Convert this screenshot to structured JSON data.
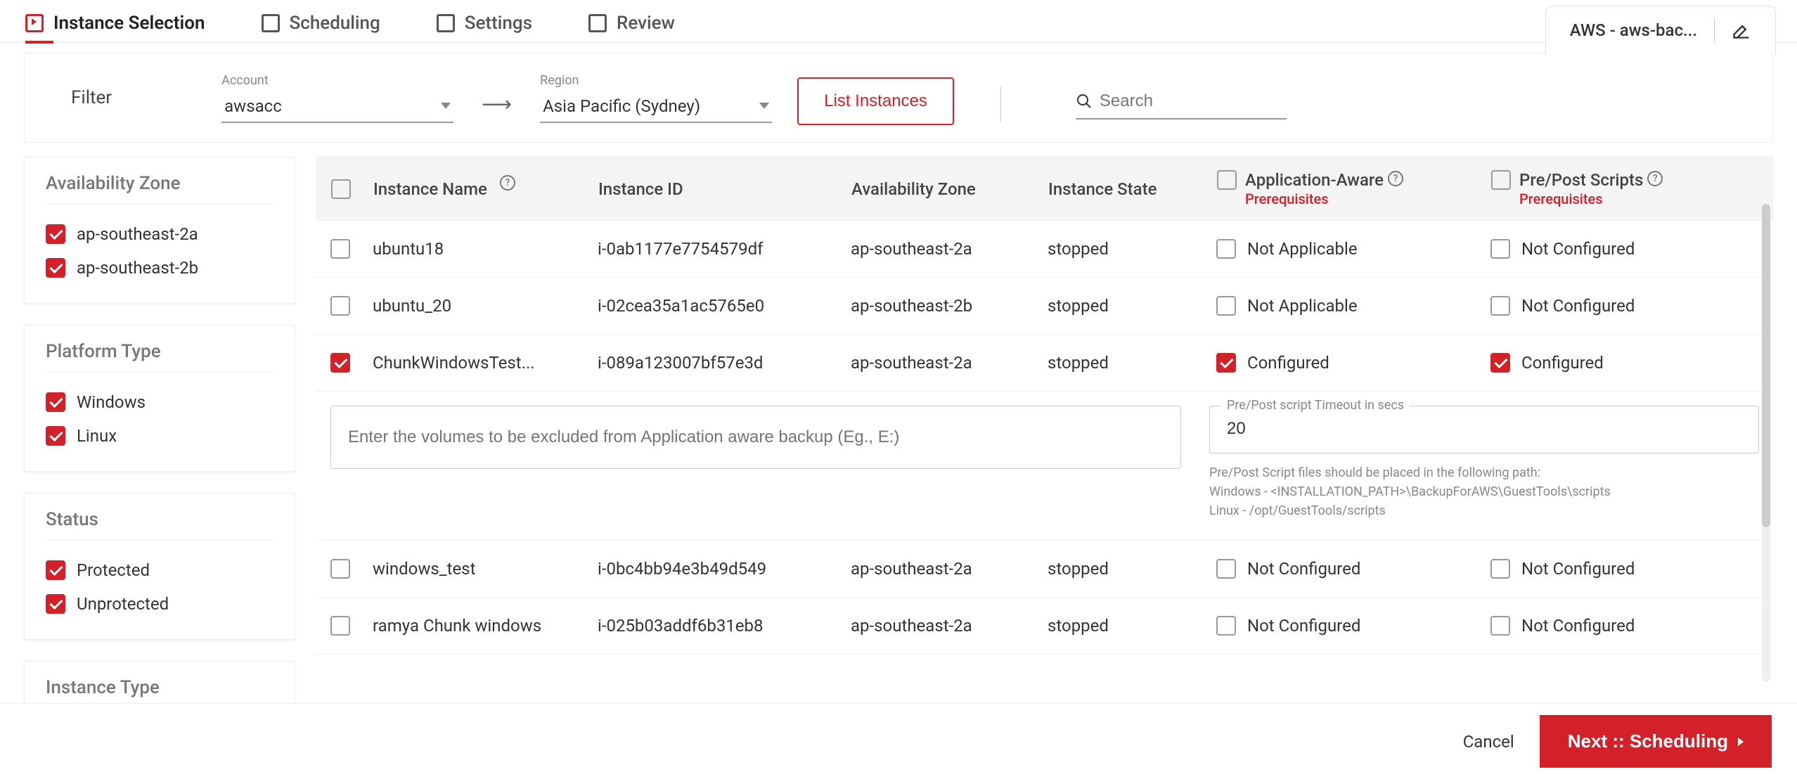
{
  "wizard": {
    "tabs": [
      {
        "label": "Instance Selection",
        "active": true
      },
      {
        "label": "Scheduling",
        "active": false
      },
      {
        "label": "Settings",
        "active": false
      },
      {
        "label": "Review",
        "active": false
      }
    ]
  },
  "header": {
    "context_label": "AWS - aws-bac..."
  },
  "filter_bar": {
    "title": "Filter",
    "account_label": "Account",
    "account_value": "awsacc",
    "region_label": "Region",
    "region_value": "Asia Pacific (Sydney)",
    "list_button": "List Instances",
    "search_placeholder": "Search"
  },
  "sidebar": {
    "groups": [
      {
        "title": "Availability Zone",
        "items": [
          {
            "label": "ap-southeast-2a",
            "checked": true
          },
          {
            "label": "ap-southeast-2b",
            "checked": true
          }
        ]
      },
      {
        "title": "Platform Type",
        "items": [
          {
            "label": "Windows",
            "checked": true
          },
          {
            "label": "Linux",
            "checked": true
          }
        ]
      },
      {
        "title": "Status",
        "items": [
          {
            "label": "Protected",
            "checked": true
          },
          {
            "label": "Unprotected",
            "checked": true
          }
        ]
      },
      {
        "title": "Instance Type",
        "items": []
      }
    ]
  },
  "table": {
    "headers": {
      "instance_name": "Instance Name",
      "instance_id": "Instance ID",
      "availability_zone": "Availability Zone",
      "instance_state": "Instance State",
      "app_aware": "Application-Aware",
      "prepost": "Pre/Post Scripts",
      "prereq": "Prerequisites"
    },
    "rows": [
      {
        "selected": false,
        "name": "ubuntu18",
        "id": "i-0ab1177e7754579df",
        "zone": "ap-southeast-2a",
        "state": "stopped",
        "app_aware_checked": false,
        "app_aware_label": "Not Applicable",
        "prepost_checked": false,
        "prepost_label": "Not Configured",
        "expanded": false
      },
      {
        "selected": false,
        "name": "ubuntu_20",
        "id": "i-02cea35a1ac5765e0",
        "zone": "ap-southeast-2b",
        "state": "stopped",
        "app_aware_checked": false,
        "app_aware_label": "Not Applicable",
        "prepost_checked": false,
        "prepost_label": "Not Configured",
        "expanded": false
      },
      {
        "selected": true,
        "name": "ChunkWindowsTest...",
        "id": "i-089a123007bf57e3d",
        "zone": "ap-southeast-2a",
        "state": "stopped",
        "app_aware_checked": true,
        "app_aware_label": "Configured",
        "prepost_checked": true,
        "prepost_label": "Configured",
        "expanded": true
      },
      {
        "selected": false,
        "name": "windows_test",
        "id": "i-0bc4bb94e3b49d549",
        "zone": "ap-southeast-2a",
        "state": "stopped",
        "app_aware_checked": false,
        "app_aware_label": "Not Configured",
        "prepost_checked": false,
        "prepost_label": "Not Configured",
        "expanded": false
      },
      {
        "selected": false,
        "name": "ramya Chunk windows",
        "id": "i-025b03addf6b31eb8",
        "zone": "ap-southeast-2a",
        "state": "stopped",
        "app_aware_checked": false,
        "app_aware_label": "Not Configured",
        "prepost_checked": false,
        "prepost_label": "Not Configured",
        "expanded": false
      }
    ]
  },
  "expand_panel": {
    "exclude_placeholder": "Enter the volumes to be excluded from Application aware backup (Eg., E:)",
    "timeout_label": "Pre/Post script Timeout in secs",
    "timeout_value": "20",
    "hint_line1": "Pre/Post Script files should be placed in the following path:",
    "hint_line2": "Windows - <INSTALLATION_PATH>\\BackupForAWS\\GuestTools\\scripts",
    "hint_line3": "Linux - /opt/GuestTools/scripts"
  },
  "footer": {
    "cancel": "Cancel",
    "next": "Next :: Scheduling"
  },
  "colors": {
    "accent": "#d32029"
  }
}
